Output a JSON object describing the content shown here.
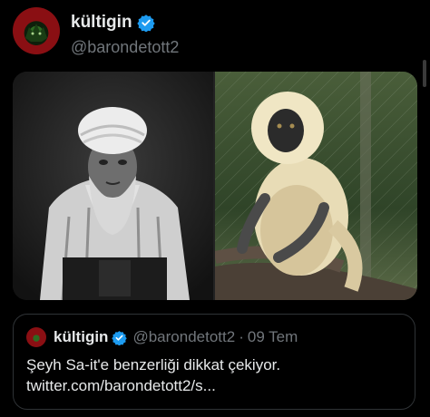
{
  "tweet": {
    "author": {
      "display_name": "kültigin",
      "handle": "@barondetott2",
      "verified": true
    },
    "media": [
      {
        "description_icon": "photo-old-man-turban"
      },
      {
        "description_icon": "photo-monkey-langur"
      }
    ]
  },
  "quoted_tweet": {
    "author": {
      "display_name": "kültigin",
      "handle": "@barondetott2",
      "verified": true
    },
    "separator": "·",
    "date": "09 Tem",
    "text": "Şeyh Sa-it'e benzerliği dikkat çekiyor. twitter.com/barondetott2/s..."
  },
  "colors": {
    "background": "#000000",
    "text_primary": "#e7e9ea",
    "text_secondary": "#71767b",
    "verified_blue": "#1d9bf0",
    "border": "#2f3336"
  }
}
